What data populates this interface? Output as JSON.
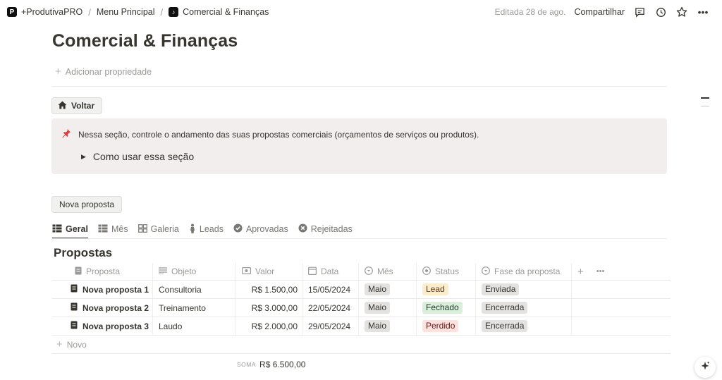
{
  "breadcrumb": {
    "workspace": "+ProdutivaPRO",
    "parent": "Menu Principal",
    "current": "Comercial & Finanças"
  },
  "topbar": {
    "edited": "Editada 28 de ago.",
    "share": "Compartilhar"
  },
  "page": {
    "title": "Comercial & Finanças",
    "add_property": "Adicionar propriedade",
    "back_button": "Voltar"
  },
  "callout": {
    "text": "Nessa seção, controle o andamento das suas propostas comerciais (orçamentos de serviços ou produtos).",
    "toggle": "Como usar essa seção"
  },
  "new_proposal_button": "Nova proposta",
  "tabs": [
    {
      "label": "Geral",
      "icon": "table-icon",
      "active": true
    },
    {
      "label": "Mês",
      "icon": "table-icon"
    },
    {
      "label": "Galeria",
      "icon": "gallery-icon"
    },
    {
      "label": "Leads",
      "icon": "person-icon"
    },
    {
      "label": "Aprovadas",
      "icon": "check-circle-icon"
    },
    {
      "label": "Rejeitadas",
      "icon": "x-circle-icon"
    }
  ],
  "database": {
    "title": "Propostas",
    "columns": [
      "Proposta",
      "Objeto",
      "Valor",
      "Data",
      "Mês",
      "Status",
      "Fase da proposta"
    ],
    "rows": [
      {
        "proposta": "Nova proposta 1",
        "objeto": "Consultoria",
        "valor": "R$ 1.500,00",
        "data": "15/05/2024",
        "mes": "Maio",
        "status": "Lead",
        "fase": "Enviada"
      },
      {
        "proposta": "Nova proposta 2",
        "objeto": "Treinamento",
        "valor": "R$ 3.000,00",
        "data": "22/05/2024",
        "mes": "Maio",
        "status": "Fechado",
        "fase": "Encerrada"
      },
      {
        "proposta": "Nova proposta 3",
        "objeto": "Laudo",
        "valor": "R$ 2.000,00",
        "data": "29/05/2024",
        "mes": "Maio",
        "status": "Perdido",
        "fase": "Encerrada"
      }
    ],
    "new_row": "Novo",
    "sum_label": "SOMA",
    "sum_value": "R$ 6.500,00"
  },
  "colors": {
    "callout_bg": "#f3eeee",
    "lead": "#fbeccc",
    "fechado": "#dbeddb",
    "perdido": "#ffe2dd",
    "gray_tag": "#e3e2e0"
  }
}
